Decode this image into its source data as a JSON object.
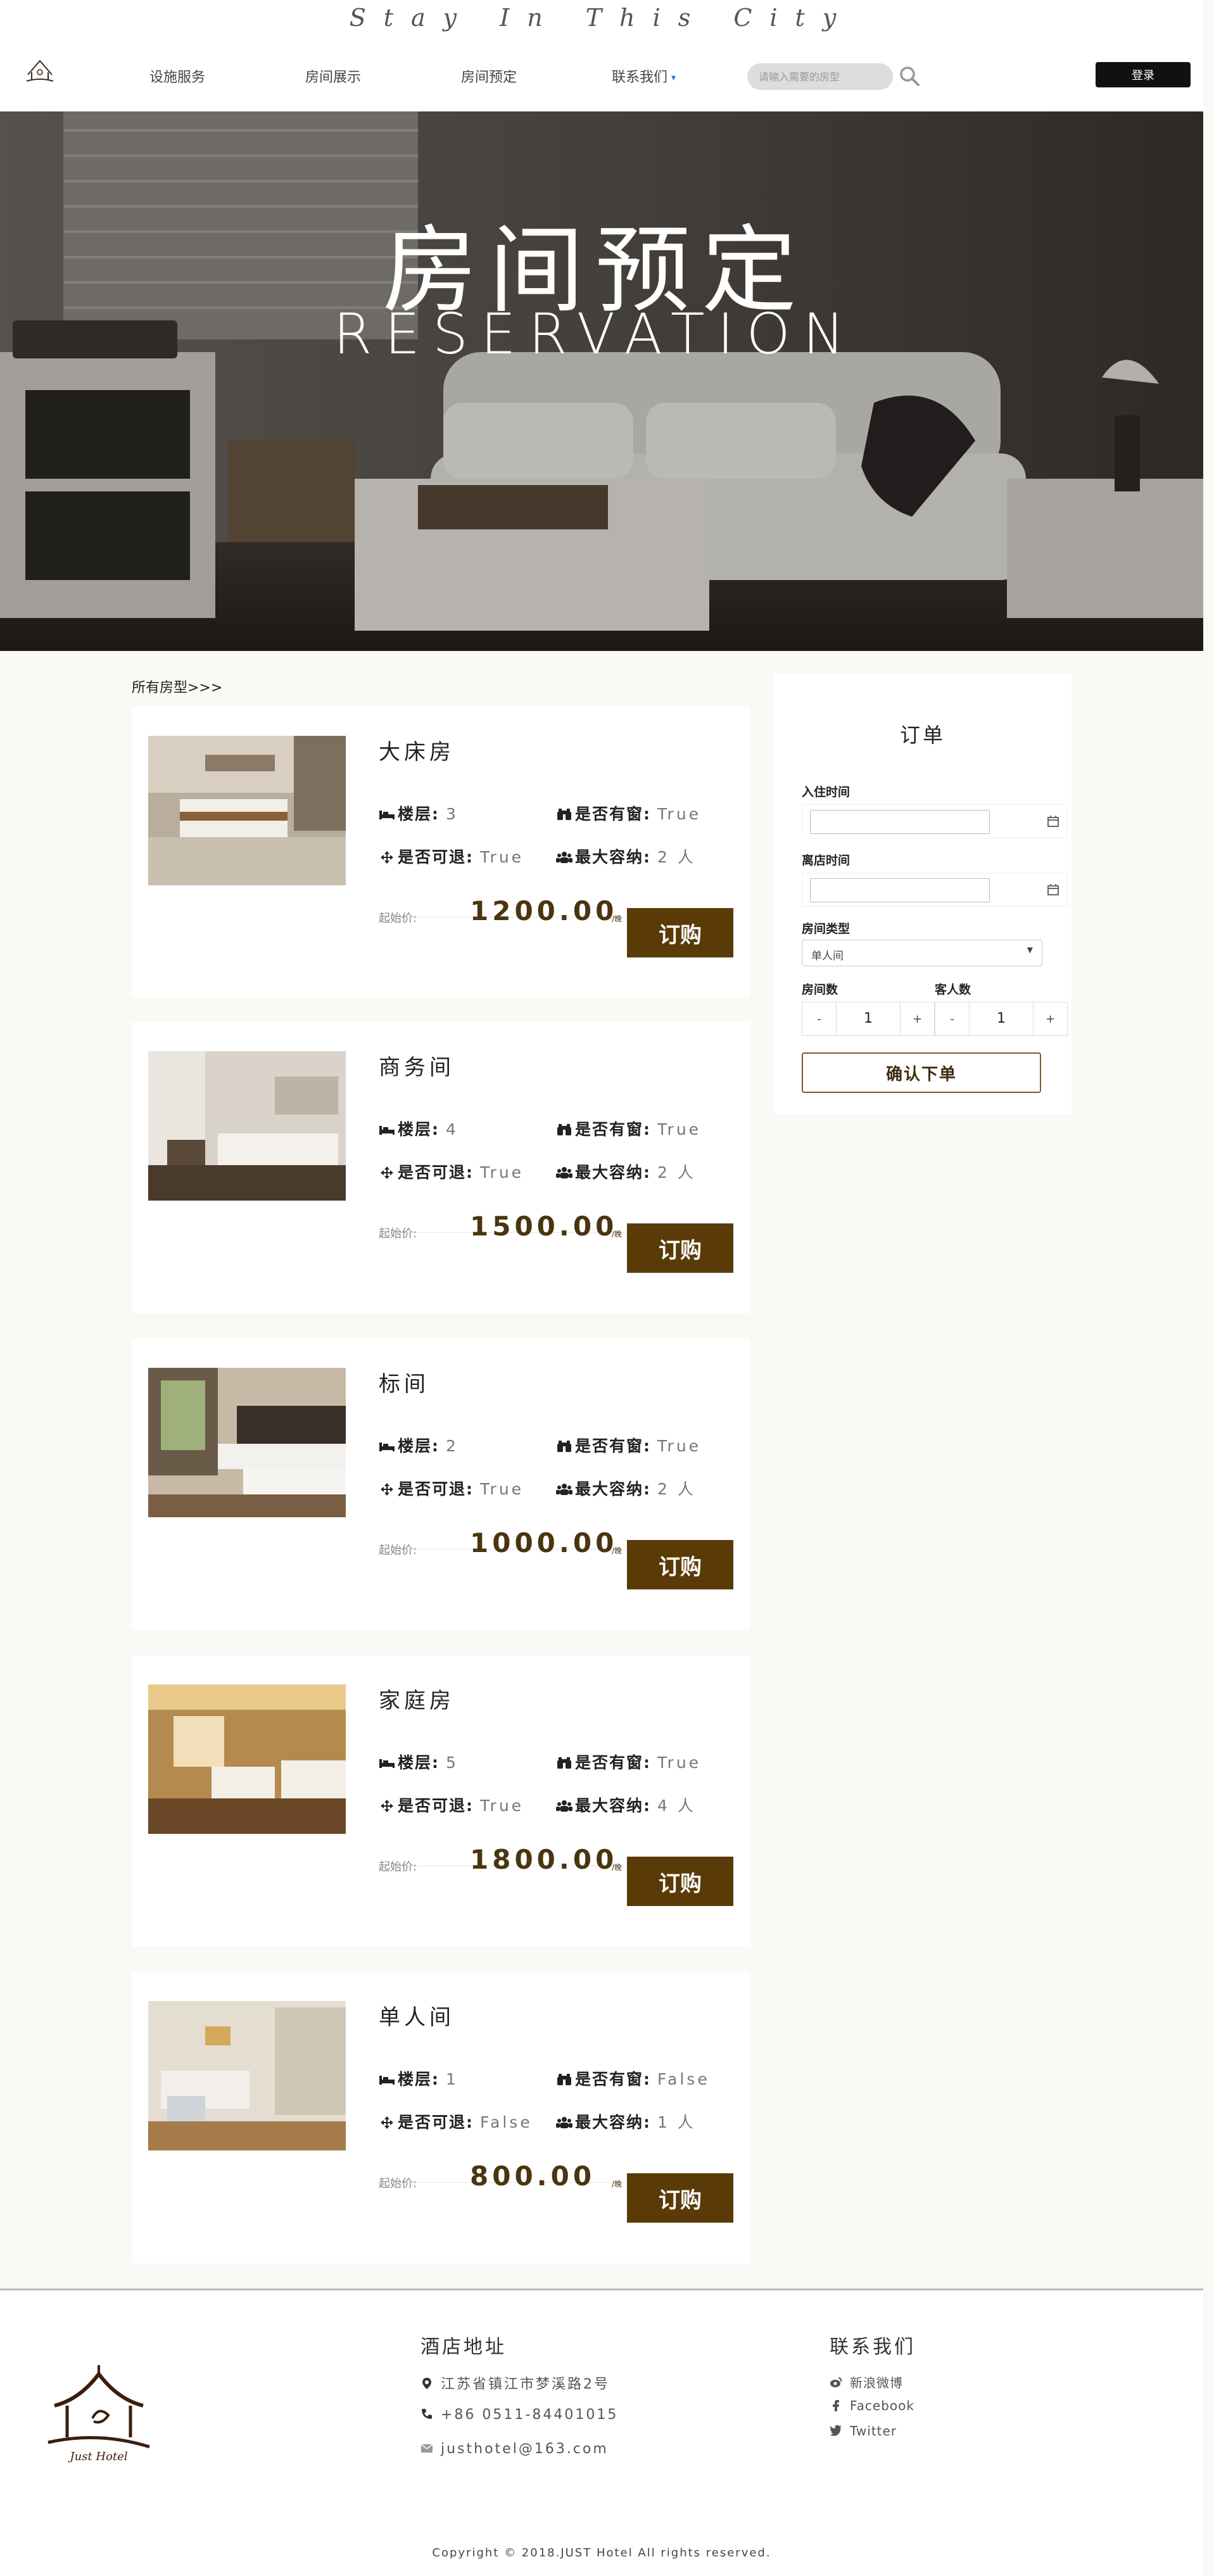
{
  "header": {
    "tagline": "Stay In This City",
    "nav": [
      {
        "label": "设施服务"
      },
      {
        "label": "房间展示"
      },
      {
        "label": "房间预定"
      },
      {
        "label": "联系我们"
      }
    ],
    "search_placeholder": "请输入需要的房型",
    "login_label": "登录"
  },
  "hero": {
    "title": "房间预定",
    "subtitle": "RESERVATION"
  },
  "breadcrumb": "所有房型>>>",
  "room_labels": {
    "floor": "楼层:",
    "window": "是否有窗:",
    "refund": "是否可退:",
    "capacity": "最大容纳:",
    "price_label": "起始价:",
    "price_unit": "/晚",
    "buy": "订购"
  },
  "rooms": [
    {
      "name": "大床房",
      "floor": "3",
      "window": "True",
      "refund": "True",
      "capacity": "2 人",
      "price": "1200.00"
    },
    {
      "name": "商务间",
      "floor": "4",
      "window": "True",
      "refund": "True",
      "capacity": "2 人",
      "price": "1500.00"
    },
    {
      "name": "标间",
      "floor": "2",
      "window": "True",
      "refund": "True",
      "capacity": "2 人",
      "price": "1000.00"
    },
    {
      "name": "家庭房",
      "floor": "5",
      "window": "True",
      "refund": "True",
      "capacity": "4 人",
      "price": "1800.00"
    },
    {
      "name": "单人间",
      "floor": "1",
      "window": "False",
      "refund": "False",
      "capacity": "1 人",
      "price": "800.00"
    }
  ],
  "order": {
    "title": "订单",
    "checkin_label": "入住时间",
    "checkout_label": "离店时间",
    "room_type_label": "房间类型",
    "room_type_value": "单人间",
    "room_count_label": "房间数",
    "guest_count_label": "客人数",
    "room_count": "1",
    "guest_count": "1",
    "minus": "-",
    "plus": "+",
    "confirm_label": "确认下单"
  },
  "footer": {
    "address_heading": "酒店地址",
    "address": "江苏省镇江市梦溪路2号",
    "phone": "+86 0511-84401015",
    "email": "justhotel@163.com",
    "contact_heading": "联系我们",
    "links": [
      "新浪微博",
      "Facebook",
      "Twitter"
    ],
    "logo_text": "Just Hotel",
    "copyright": "Copyright © 2018.JUST Hotel All rights reserved."
  },
  "colors": {
    "accent_brown": "#5a3b08",
    "price_brown": "#4a3510",
    "page_bg": "#faf9f6"
  }
}
